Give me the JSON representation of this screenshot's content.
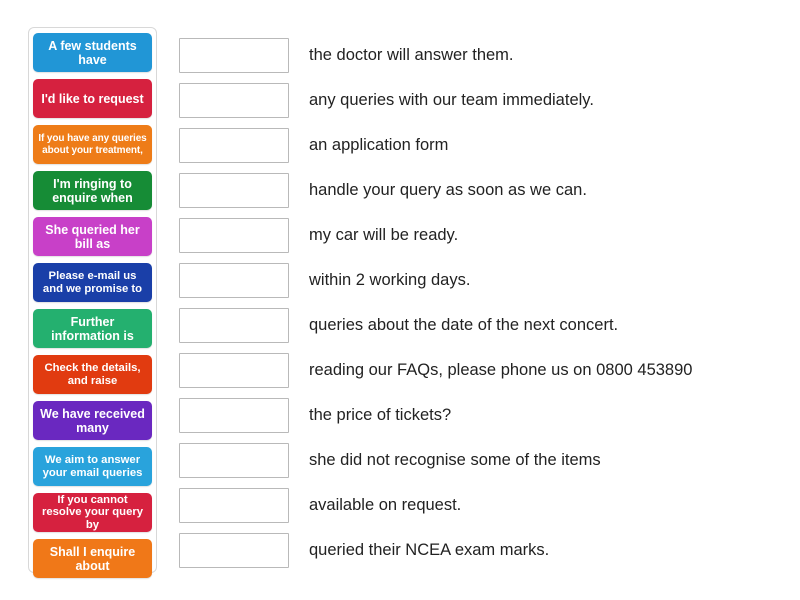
{
  "activity": {
    "type": "match-up-drag-and-drop",
    "tile_panel_label": "draggable sentence starters",
    "answer_panel_label": "sentence endings with empty drop boxes"
  },
  "tiles": [
    {
      "text": "A few students have",
      "color": "#2196D6",
      "text_size": "normal"
    },
    {
      "text": "I'd like to request",
      "color": "#D6213F",
      "text_size": "normal"
    },
    {
      "text": "If you have any queries about your treatment,",
      "color": "#EE7C18",
      "text_size": "small"
    },
    {
      "text": "I'm ringing to enquire when",
      "color": "#168C36",
      "text_size": "normal"
    },
    {
      "text": "She queried her bill as",
      "color": "#C840C8",
      "text_size": "normal"
    },
    {
      "text": "Please e-mail us and we promise to",
      "color": "#1A3FA8",
      "text_size": "mid"
    },
    {
      "text": "Further information is",
      "color": "#24B06F",
      "text_size": "normal"
    },
    {
      "text": "Check the details, and raise",
      "color": "#E13B10",
      "text_size": "mid"
    },
    {
      "text": "We have received many",
      "color": "#6A28C0",
      "text_size": "normal"
    },
    {
      "text": "We aim to answer your email queries",
      "color": "#29A3DC",
      "text_size": "mid"
    },
    {
      "text": "If you cannot resolve your query by",
      "color": "#D6213F",
      "text_size": "mid"
    },
    {
      "text": "Shall I enquire about",
      "color": "#F07818",
      "text_size": "normal"
    }
  ],
  "rows": [
    {
      "answer": "the doctor will answer them.",
      "drop_value": ""
    },
    {
      "answer": "any queries with our team immediately.",
      "drop_value": ""
    },
    {
      "answer": "an application form",
      "drop_value": ""
    },
    {
      "answer": "handle your query as soon as we can.",
      "drop_value": ""
    },
    {
      "answer": "my car will be ready.",
      "drop_value": ""
    },
    {
      "answer": "within 2 working days.",
      "drop_value": ""
    },
    {
      "answer": "queries about the date of the next concert.",
      "drop_value": ""
    },
    {
      "answer": "reading our FAQs, please phone us on 0800 453890",
      "drop_value": ""
    },
    {
      "answer": "the price of tickets?",
      "drop_value": ""
    },
    {
      "answer": "she did not recognise some of the items",
      "drop_value": ""
    },
    {
      "answer": "available on request.",
      "drop_value": ""
    },
    {
      "answer": "queried their NCEA exam marks.",
      "drop_value": ""
    }
  ],
  "colors": {
    "page_background": "#ffffff",
    "panel_border": "#d8d8d8",
    "dropzone_border": "#b9b9b9",
    "answer_text": "#222222",
    "tile_text": "#ffffff"
  }
}
